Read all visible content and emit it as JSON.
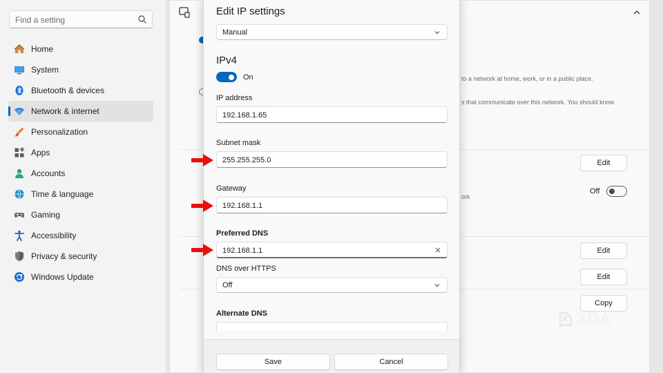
{
  "sidebar": {
    "search_placeholder": "Find a setting",
    "items": [
      {
        "label": "Home",
        "icon": "home-icon"
      },
      {
        "label": "System",
        "icon": "monitor-icon"
      },
      {
        "label": "Bluetooth & devices",
        "icon": "bluetooth-icon"
      },
      {
        "label": "Network & internet",
        "icon": "wifi-icon",
        "active": true
      },
      {
        "label": "Personalization",
        "icon": "brush-icon"
      },
      {
        "label": "Apps",
        "icon": "apps-icon"
      },
      {
        "label": "Accounts",
        "icon": "person-icon"
      },
      {
        "label": "Time & language",
        "icon": "globe-clock-icon"
      },
      {
        "label": "Gaming",
        "icon": "gamepad-icon"
      },
      {
        "label": "Accessibility",
        "icon": "accessibility-icon"
      },
      {
        "label": "Privacy & security",
        "icon": "shield-icon"
      },
      {
        "label": "Windows Update",
        "icon": "update-icon"
      }
    ]
  },
  "background": {
    "text_public_place": "to a network at home, work, or in a public place.",
    "text_communicate": "s that communicate over this network. You should know",
    "text_work": "ork",
    "off_label": "Off",
    "edit_label": "Edit",
    "copy_label": "Copy"
  },
  "dialog": {
    "title": "Edit IP settings",
    "mode": "Manual",
    "section": "IPv4",
    "ipv4_toggle_state": "On",
    "ip_address_label": "IP address",
    "ip_address_value": "192.168.1.65",
    "subnet_label": "Subnet mask",
    "subnet_value": "255.255.255.0",
    "gateway_label": "Gateway",
    "gateway_value": "192.168.1.1",
    "preferred_dns_label": "Preferred DNS",
    "preferred_dns_value": "192.168.1.1",
    "dns_https_label": "DNS over HTTPS",
    "dns_https_value": "Off",
    "alternate_dns_label": "Alternate DNS",
    "save_label": "Save",
    "cancel_label": "Cancel"
  },
  "watermark": {
    "text": "XDA"
  },
  "colors": {
    "accent": "#0067c0",
    "arrow": "#e8100b"
  }
}
